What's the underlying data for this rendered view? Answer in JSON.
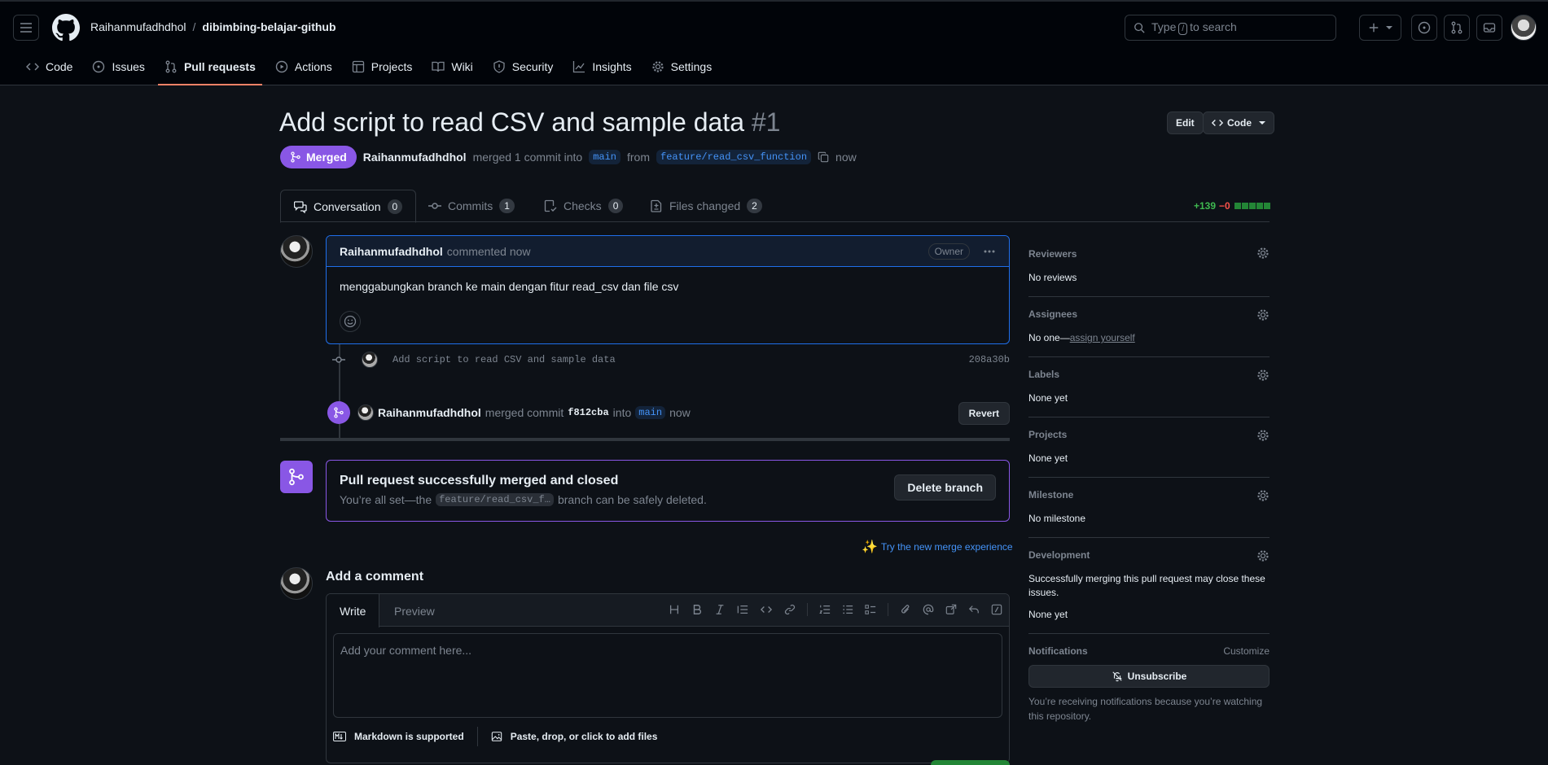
{
  "header": {
    "owner": "Raihanmufadhdhol",
    "separator": "/",
    "repo": "dibimbing-belajar-github",
    "search_prefix": "Type",
    "search_key": "/",
    "search_suffix": "to search",
    "repo_nav": [
      {
        "label": "Code",
        "icon": "code-icon"
      },
      {
        "label": "Issues",
        "icon": "issue-opened-icon"
      },
      {
        "label": "Pull requests",
        "icon": "git-pull-request-icon",
        "active": true
      },
      {
        "label": "Actions",
        "icon": "play-icon"
      },
      {
        "label": "Projects",
        "icon": "table-icon"
      },
      {
        "label": "Wiki",
        "icon": "book-icon"
      },
      {
        "label": "Security",
        "icon": "shield-icon"
      },
      {
        "label": "Insights",
        "icon": "graph-icon"
      },
      {
        "label": "Settings",
        "icon": "gear-icon"
      }
    ]
  },
  "pr": {
    "title": "Add script to read CSV and sample data",
    "number": "#1",
    "edit_label": "Edit",
    "code_label": "Code",
    "state_label": "Merged",
    "author": "Raihanmufadhdhol",
    "merged_text": "merged 1 commit into",
    "base_branch": "main",
    "from_text": "from",
    "head_branch": "feature/read_csv_function",
    "time": "now"
  },
  "tabs": [
    {
      "label": "Conversation",
      "count": "0",
      "icon": "comment-discussion-icon",
      "active": true
    },
    {
      "label": "Commits",
      "count": "1",
      "icon": "git-commit-icon"
    },
    {
      "label": "Checks",
      "count": "0",
      "icon": "checklist-icon"
    },
    {
      "label": "Files changed",
      "count": "2",
      "icon": "file-diff-icon"
    }
  ],
  "diffstat": {
    "additions": "+139",
    "deletions": "−0",
    "blocks": 5
  },
  "comment": {
    "author": "Raihanmufadhdhol",
    "action": "commented now",
    "badge": "Owner",
    "body": "menggabungkan branch ke main dengan fitur read_csv dan file csv"
  },
  "commit": {
    "message": "Add script to read CSV and sample data",
    "sha": "208a30b"
  },
  "merge_event": {
    "author": "Raihanmufadhdhol",
    "text1": "merged commit",
    "sha": "f812cba",
    "text2": "into",
    "branch": "main",
    "time": "now",
    "revert_label": "Revert"
  },
  "merged_box": {
    "title": "Pull request successfully merged and closed",
    "sub_prefix": "You’re all set—the",
    "branch": "feature/read_csv_f…",
    "sub_suffix": "branch can be safely deleted.",
    "delete_label": "Delete branch",
    "try_link": "Try the new merge experience"
  },
  "editor": {
    "title": "Add a comment",
    "write_tab": "Write",
    "preview_tab": "Preview",
    "placeholder": "Add your comment here...",
    "markdown_note": "Markdown is supported",
    "attach_note": "Paste, drop, or click to add files"
  },
  "sidebar": {
    "reviewers": {
      "title": "Reviewers",
      "value": "No reviews"
    },
    "assignees": {
      "title": "Assignees",
      "value_prefix": "No one—",
      "link": "assign yourself"
    },
    "labels": {
      "title": "Labels",
      "value": "None yet"
    },
    "projects": {
      "title": "Projects",
      "value": "None yet"
    },
    "milestone": {
      "title": "Milestone",
      "value": "No milestone"
    },
    "development": {
      "title": "Development",
      "note": "Successfully merging this pull request may close these issues.",
      "value": "None yet"
    },
    "notifications": {
      "title": "Notifications",
      "customize": "Customize",
      "button": "Unsubscribe",
      "note": "You’re receiving notifications because you’re watching this repository."
    }
  },
  "colors": {
    "merged": "#8957e5",
    "accent": "#4493f8",
    "underline": "#f78166"
  }
}
